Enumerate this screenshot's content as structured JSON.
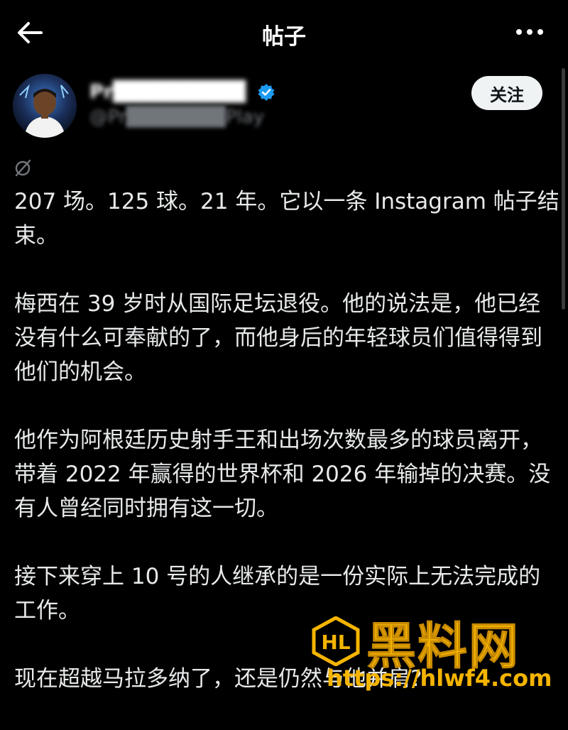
{
  "header": {
    "title": "帖子",
    "back_icon": "arrow-left-icon",
    "more_icon": "more-horizontal-icon"
  },
  "author": {
    "name": "Pr█████████",
    "handle": "@Pr███████Play",
    "follow_label": "关注"
  },
  "post": {
    "paragraphs": [
      "207 场。125 球。21 年。它以一条 Instagram 帖子结束。",
      "梅西在 39 岁时从国际足坛退役。他的说法是，他已经没有什么可奉献的了，而他身后的年轻球员们值得得到他们的机会。",
      "他作为阿根廷历史射手王和出场次数最多的球员离开，带着 2022 年赢得的世界杯和 2026 年输掉的决赛。没有人曾经同时拥有这一切。",
      "接下来穿上 10 号的人继承的是一份实际上无法完成的工作。",
      "现在超越马拉多纳了，还是仍然与他并肩?"
    ]
  },
  "watermark": {
    "logo_text": "HL",
    "title": "黑料网",
    "url": "https://hlwf4.com"
  },
  "colors": {
    "background": "#000000",
    "text": "#e7e9ea",
    "secondary": "#71767b",
    "follow_bg": "#eff3f4",
    "verified": "#1d9bf0",
    "watermark": "#f4b400"
  }
}
